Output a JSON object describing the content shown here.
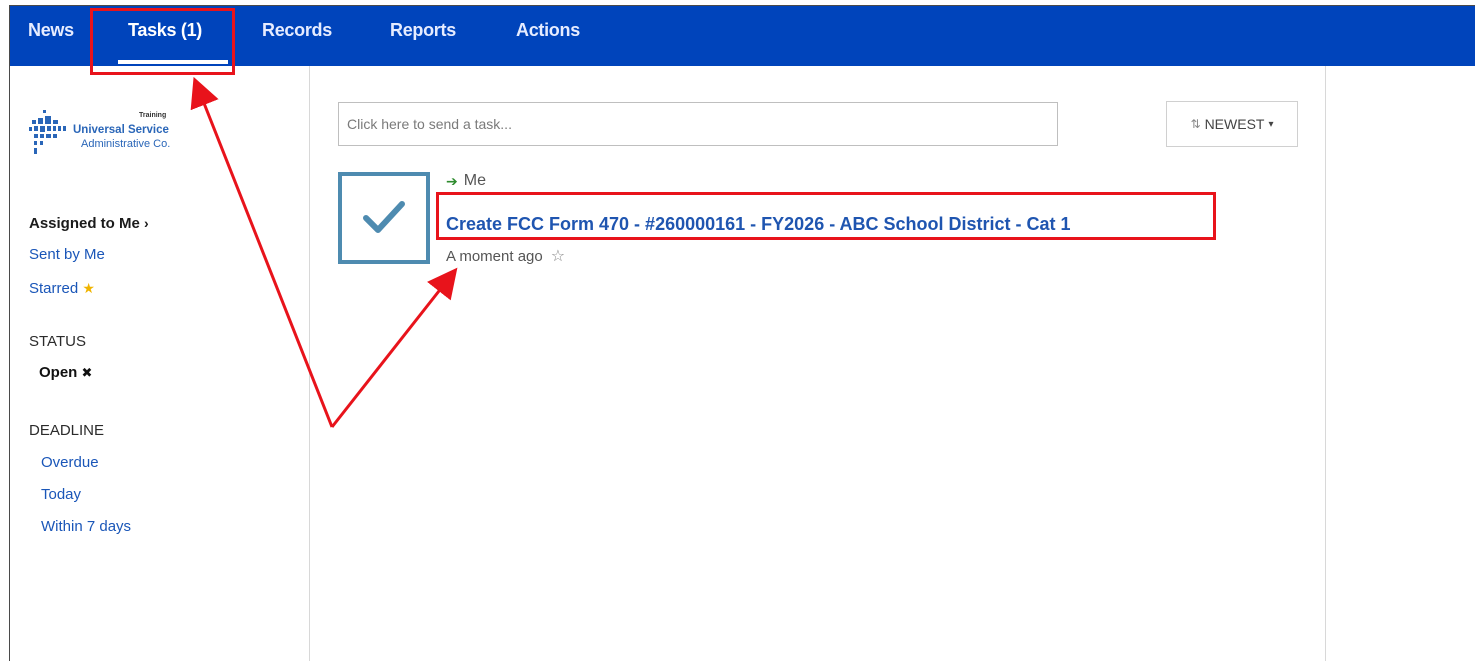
{
  "nav": {
    "items": [
      {
        "label": "News"
      },
      {
        "label": "Tasks (1)"
      },
      {
        "label": "Records"
      },
      {
        "label": "Reports"
      },
      {
        "label": "Actions"
      }
    ]
  },
  "logo": {
    "training": "Training",
    "line1": "Universal Service",
    "line2": "Administrative Co."
  },
  "sidebar": {
    "assigned_to_me": "Assigned to Me",
    "sent_by_me": "Sent by Me",
    "starred": "Starred",
    "status_heading": "STATUS",
    "status_open": "Open",
    "deadline_heading": "DEADLINE",
    "deadline_items": [
      "Overdue",
      "Today",
      "Within 7 days"
    ]
  },
  "main": {
    "task_input_placeholder": "Click here to send a task...",
    "sort_label": "NEWEST"
  },
  "task": {
    "from": "Me",
    "title": "Create FCC Form 470 - #260000161 - FY2026 - ABC School District - Cat 1",
    "time": "A moment ago"
  },
  "colors": {
    "nav_bg": "#0044bb",
    "annotation": "#e8131b",
    "link": "#1f55b0"
  }
}
